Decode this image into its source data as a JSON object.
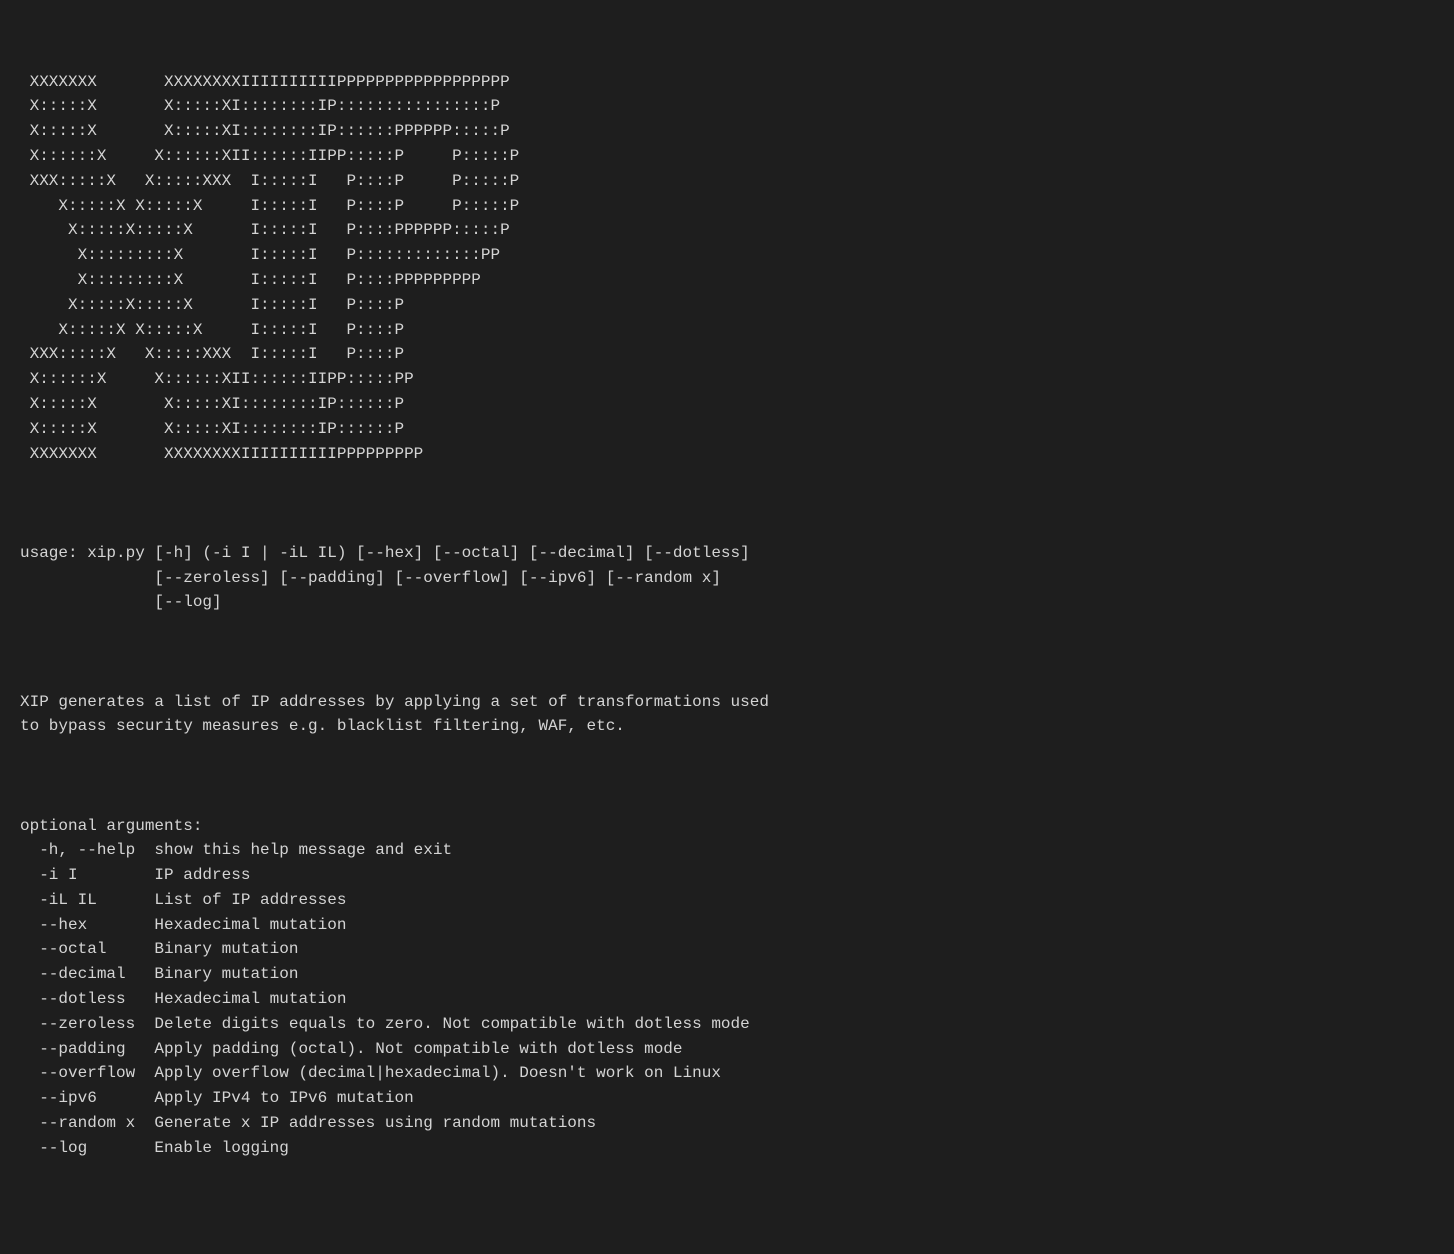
{
  "terminal": {
    "ascii_art": [
      " XXXXXXX       XXXXXXXXIIIIIIIIIIPPPPPPPPPPPPPPPPPP",
      " X:::::X       X:::::XI::::::::IP::::::::::::::::P",
      " X:::::X       X:::::XI::::::::IP::::::PPPPPP:::::P",
      " X::::::X     X::::::XII::::::IIPP:::::P     P:::::P",
      " XXX:::::X   X:::::XXX  I:::::I   P::::P     P:::::P",
      "    X:::::X X:::::X     I:::::I   P::::P     P:::::P",
      "     X:::::X:::::X      I:::::I   P::::PPPPPP:::::P",
      "      X:::::::::X       I:::::I   P:::::::::::::PP",
      "      X:::::::::X       I:::::I   P::::PPPPPPPPP",
      "     X:::::X:::::X      I:::::I   P::::P",
      "    X:::::X X:::::X     I:::::I   P::::P",
      " XXX:::::X   X:::::XXX  I:::::I   P::::P",
      " X::::::X     X::::::XII::::::IIPP:::::PP",
      " X:::::X       X:::::XI::::::::IP::::::P",
      " X:::::X       X:::::XI::::::::IP::::::P",
      " XXXXXXX       XXXXXXXXIIIIIIIIIIPPPPPPPPP"
    ],
    "usage_line1": "usage: xip.py [-h] (-i I | -iL IL) [--hex] [--octal] [--decimal] [--dotless]",
    "usage_line2": "              [--zeroless] [--padding] [--overflow] [--ipv6] [--random x]",
    "usage_line3": "              [--log]",
    "description_line1": "XIP generates a list of IP addresses by applying a set of transformations used",
    "description_line2": "to bypass security measures e.g. blacklist filtering, WAF, etc.",
    "optional_header": "optional arguments:",
    "args": [
      {
        "flag": "  -h, --help",
        "desc": "show this help message and exit"
      },
      {
        "flag": "  -i I      ",
        "desc": "IP address"
      },
      {
        "flag": "  -iL IL    ",
        "desc": "List of IP addresses"
      },
      {
        "flag": "  --hex     ",
        "desc": "Hexadecimal mutation"
      },
      {
        "flag": "  --octal   ",
        "desc": "Binary mutation"
      },
      {
        "flag": "  --decimal ",
        "desc": "Binary mutation"
      },
      {
        "flag": "  --dotless ",
        "desc": "Hexadecimal mutation"
      },
      {
        "flag": "  --zeroless",
        "desc": "Delete digits equals to zero. Not compatible with dotless mode"
      },
      {
        "flag": "  --padding ",
        "desc": "Apply padding (octal). Not compatible with dotless mode"
      },
      {
        "flag": "  --overflow",
        "desc": "Apply overflow (decimal|hexadecimal). Doesn't work on Linux"
      },
      {
        "flag": "  --ipv6    ",
        "desc": "Apply IPv4 to IPv6 mutation"
      },
      {
        "flag": "  --random x",
        "desc": "Generate x IP addresses using random mutations"
      },
      {
        "flag": "  --log     ",
        "desc": "Enable logging"
      }
    ]
  }
}
